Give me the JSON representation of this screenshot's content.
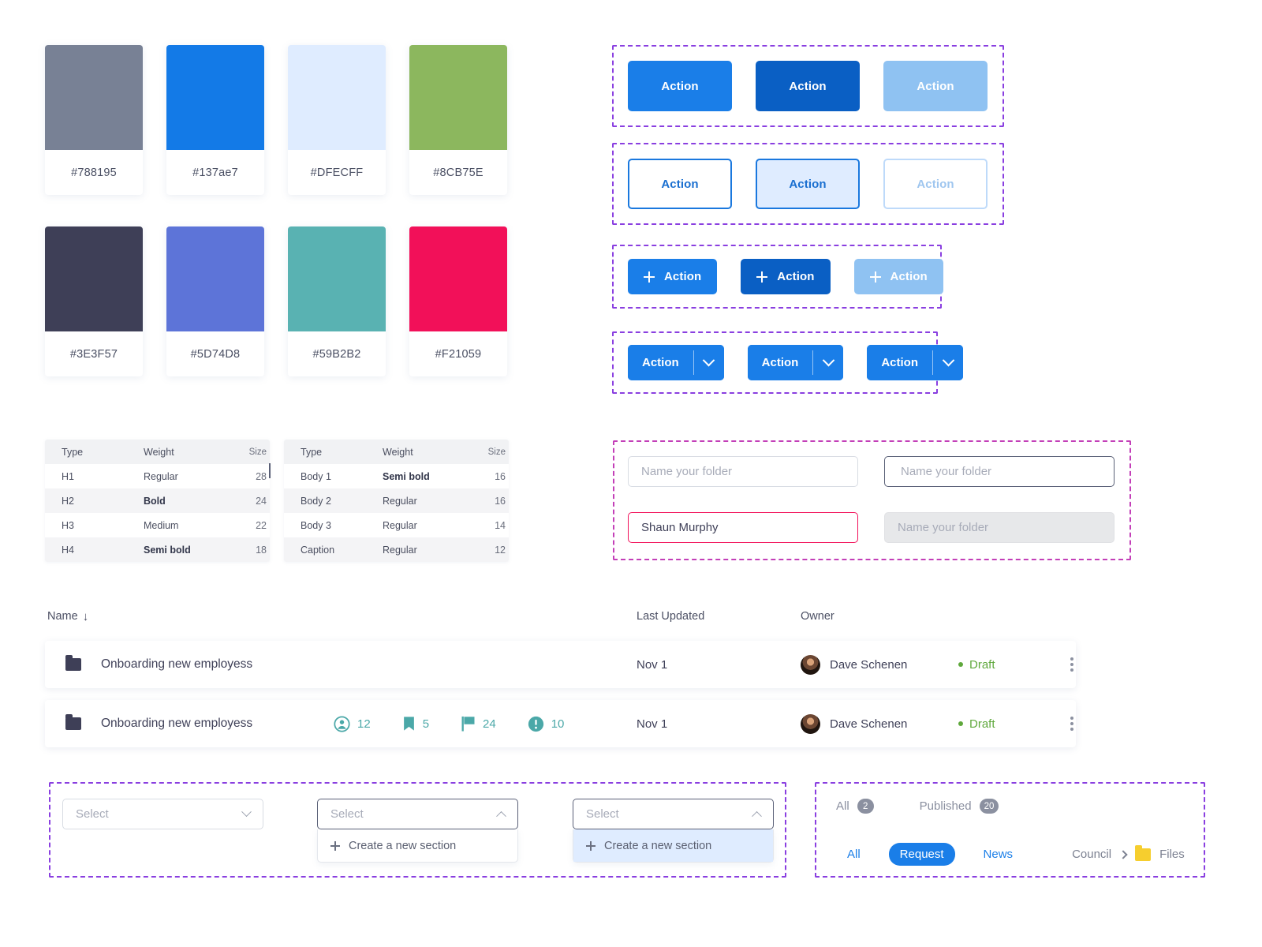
{
  "palette": {
    "swatches": [
      {
        "hex": "#788195",
        "label": "#788195"
      },
      {
        "hex": "#137ae7",
        "label": "#137ae7"
      },
      {
        "hex": "#DFECFF",
        "label": "#DFECFF"
      },
      {
        "hex": "#8CB75E",
        "label": "#8CB75E"
      },
      {
        "hex": "#3E3F57",
        "label": "#3E3F57"
      },
      {
        "hex": "#5D74D8",
        "label": "#5D74D8"
      },
      {
        "hex": "#59B2B2",
        "label": "#59B2B2"
      },
      {
        "hex": "#F21059",
        "label": "#F21059"
      }
    ]
  },
  "typography": {
    "headers": {
      "type": "Type",
      "weight": "Weight",
      "size": "Size"
    },
    "table_one": [
      {
        "type": "H1",
        "weight": "Regular",
        "size": "28",
        "bold": false
      },
      {
        "type": "H2",
        "weight": "Bold",
        "size": "24",
        "bold": true
      },
      {
        "type": "H3",
        "weight": "Medium",
        "size": "22",
        "bold": false
      },
      {
        "type": "H4",
        "weight": "Semi bold",
        "size": "18",
        "bold": true
      }
    ],
    "table_two": [
      {
        "type": "Body 1",
        "weight": "Semi bold",
        "size": "16",
        "bold": true
      },
      {
        "type": "Body 2",
        "weight": "Regular",
        "size": "16",
        "bold": false
      },
      {
        "type": "Body 3",
        "weight": "Regular",
        "size": "14",
        "bold": false
      },
      {
        "type": "Caption",
        "weight": "Regular",
        "size": "12",
        "bold": false
      }
    ]
  },
  "buttons": {
    "solid": [
      {
        "label": "Action",
        "state": "default"
      },
      {
        "label": "Action",
        "state": "pressed"
      },
      {
        "label": "Action",
        "state": "disabled"
      }
    ],
    "outline": [
      {
        "label": "Action",
        "state": "default"
      },
      {
        "label": "Action",
        "state": "pressed"
      },
      {
        "label": "Action",
        "state": "disabled"
      }
    ],
    "icon": [
      {
        "label": "Action",
        "icon": "plus-icon",
        "state": "default"
      },
      {
        "label": "Action",
        "icon": "plus-icon",
        "state": "pressed"
      },
      {
        "label": "Action",
        "icon": "plus-icon",
        "state": "disabled"
      }
    ],
    "split": [
      {
        "label": "Action",
        "icon": "chevron-down-icon"
      },
      {
        "label": "Action",
        "icon": "chevron-down-icon"
      },
      {
        "label": "Action",
        "icon": "chevron-down-icon"
      }
    ]
  },
  "inputs": {
    "default": {
      "value": "",
      "placeholder": "Name your folder"
    },
    "focused": {
      "value": "",
      "placeholder": "Name your folder"
    },
    "error": {
      "value": "Shaun Murphy",
      "placeholder": "Name your folder"
    },
    "disabled": {
      "value": "",
      "placeholder": "Name your folder"
    }
  },
  "file_table": {
    "columns": {
      "name": "Name",
      "sort_icon": "↓",
      "last_updated": "Last Updated",
      "owner": "Owner"
    },
    "rows": [
      {
        "name": "Onboarding new employess",
        "stats": [],
        "last_updated": "Nov 1",
        "owner": "Dave Schenen",
        "status": "Draft"
      },
      {
        "name": "Onboarding new employess",
        "stats": [
          {
            "icon": "person-icon",
            "count": "12"
          },
          {
            "icon": "bookmark-icon",
            "count": "5"
          },
          {
            "icon": "flag-icon",
            "count": "24"
          },
          {
            "icon": "alert-icon",
            "count": "10"
          }
        ],
        "last_updated": "Nov 1",
        "owner": "Dave Schenen",
        "status": "Draft"
      }
    ]
  },
  "selects": [
    {
      "placeholder": "Select",
      "state": "closed",
      "caret": "chevron-down-icon",
      "option": null
    },
    {
      "placeholder": "Select",
      "state": "open",
      "caret": "chevron-up-icon",
      "option": "Create a new section"
    },
    {
      "placeholder": "Select",
      "state": "open-hover",
      "caret": "chevron-up-icon",
      "option": "Create a new section"
    }
  ],
  "filters": {
    "tabs": [
      {
        "label": "All",
        "count": "2"
      },
      {
        "label": "Published",
        "count": "20"
      }
    ],
    "pills": [
      {
        "label": "All",
        "active": false
      },
      {
        "label": "Request",
        "active": true
      },
      {
        "label": "News",
        "active": false
      }
    ],
    "breadcrumb": {
      "parent": "Council",
      "separator": "chevron-right-icon",
      "folder_icon": "folder-icon",
      "current": "Files"
    }
  },
  "colors": {
    "primary": "#137ae7",
    "primary_dark": "#0a5fc4",
    "primary_light": "#DFECFF",
    "error": "#F21059",
    "success": "#5FA83C",
    "teal": "#59B2B2",
    "dark": "#3E3F57",
    "folder_yellow": "#F6CE2E",
    "annotation": "#8A3FE0"
  }
}
